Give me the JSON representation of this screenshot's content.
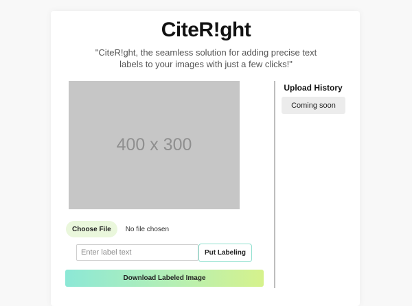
{
  "app": {
    "title": "CiteR!ght",
    "tagline": "\"CiteR!ght, the seamless solution for adding precise text labels to your images with just a few clicks!\""
  },
  "preview": {
    "placeholder_text": "400 x 300"
  },
  "file_input": {
    "button_label": "Choose File",
    "status": "No file chosen"
  },
  "label": {
    "placeholder": "Enter label text",
    "value": "",
    "put_button": "Put Labeling"
  },
  "download": {
    "button_label": "Download Labeled Image"
  },
  "history": {
    "title": "Upload History",
    "items": [
      {
        "label": "Coming soon"
      }
    ]
  },
  "colors": {
    "background": "#f8f8f8",
    "card": "#ffffff",
    "placeholder_bg": "#c6c6c6",
    "choose_btn_bg": "#eaf7dc",
    "put_btn_border": "#8fe0cf",
    "gradient_start": "#8ce8d6",
    "gradient_end": "#d6f28c",
    "history_item_bg": "#ececec"
  }
}
